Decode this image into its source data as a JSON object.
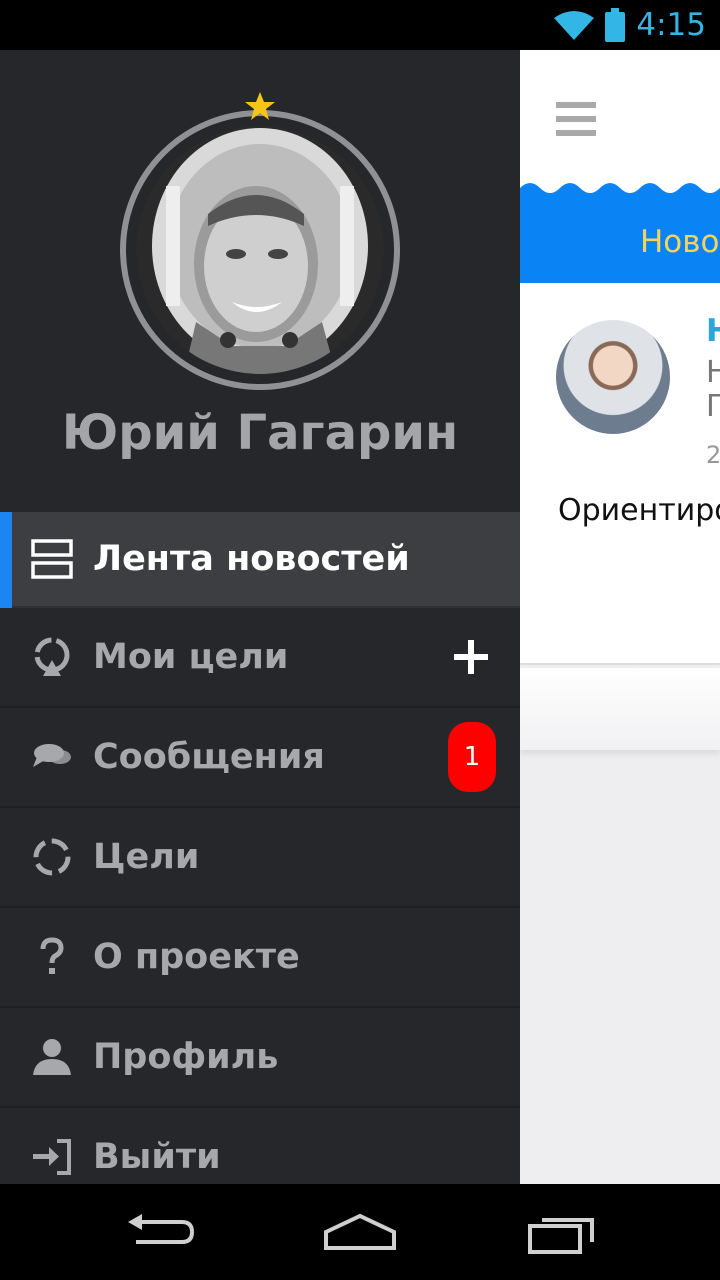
{
  "status_bar": {
    "time": "4:15",
    "icons": [
      "wifi-icon",
      "battery-icon"
    ]
  },
  "drawer": {
    "user_name": "Юрий Гагарин",
    "menu": [
      {
        "label": "Лента новостей",
        "icon": "news-feed-icon",
        "active": true
      },
      {
        "label": "Мои цели",
        "icon": "my-goals-icon",
        "action": "add"
      },
      {
        "label": "Сообщения",
        "icon": "messages-icon",
        "badge": "1"
      },
      {
        "label": "Цели",
        "icon": "goals-icon"
      },
      {
        "label": "О проекте",
        "icon": "question-icon"
      },
      {
        "label": "Профиль",
        "icon": "profile-icon"
      },
      {
        "label": "Выйти",
        "icon": "logout-icon"
      }
    ]
  },
  "content": {
    "tab_label": "Новос",
    "card": {
      "author": "Н",
      "line1": "Н",
      "line2": "П",
      "date": "2",
      "text": "Ориентиро"
    }
  },
  "colors": {
    "accent": "#1b86f2",
    "badge": "#ff0000",
    "drawer_bg": "#25272a",
    "tab_bg": "#0a84f5",
    "tab_text": "#f4d35e"
  }
}
